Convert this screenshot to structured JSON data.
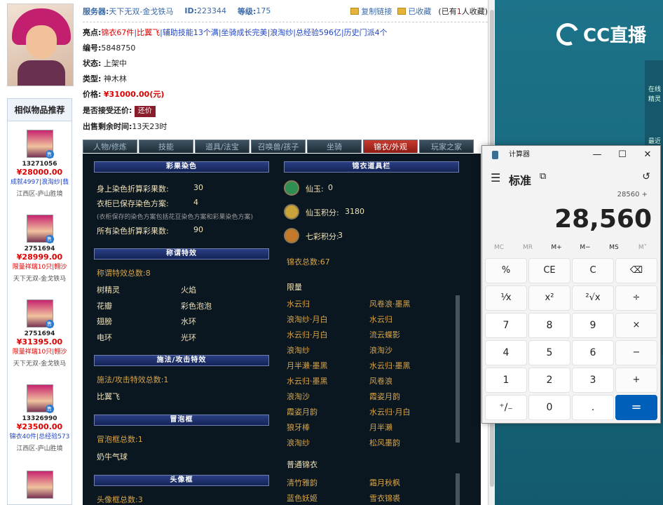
{
  "server": {
    "label": "服务器:",
    "value": "天下无双-金戈铁马",
    "id_label": "ID:",
    "id_value": "223344",
    "level_label": "等级:",
    "level_value": "175",
    "copy_link": "复制链接",
    "favorite": "已收藏",
    "fav_pre": "(已有",
    "fav_count": "1",
    "fav_post": "人收藏)"
  },
  "info": {
    "highlights_label": "亮点:",
    "highlights": [
      {
        "text": "锦衣67件",
        "red": true
      },
      {
        "text": "|",
        "red": false
      },
      {
        "text": "比翼飞",
        "red": true
      },
      {
        "text": "|辅助技能13个满|坐骑成长完美|浪淘纱|总经验596亿|历史门派4个",
        "red": false
      }
    ],
    "number_label": "编号:",
    "number": "5848750",
    "status_label": "状态:",
    "status": "上架中",
    "type_label": "类型:",
    "type": "神木林",
    "price_label": "价格:",
    "price": "¥31000.00(元)",
    "counter_label": "是否接受还价:",
    "counter_btn": "还价",
    "remaining_label": "出售剩余时间:",
    "remaining": "13天23时"
  },
  "tabs": [
    "人物/修炼",
    "技能",
    "道具/法宝",
    "召唤兽/孩子",
    "坐骑",
    "锦衣/外观",
    "玩家之家"
  ],
  "active_tab": 5,
  "similar": {
    "title": "相似物品推荐",
    "items": [
      {
        "id": "13271056",
        "price": "¥28000.00",
        "tags": "成就4997|浪淘纱|翡",
        "tag_red": false,
        "server": "江西区-庐山胜境"
      },
      {
        "id": "2751694",
        "price": "¥28999.00",
        "tags": "限量祥瑞10只|翱沙",
        "tag_red": true,
        "server": "天下无双-金戈铁马"
      },
      {
        "id": "2751694",
        "price": "¥31395.00",
        "tags": "限量祥瑞10只|翱沙",
        "tag_red": true,
        "server": "天下无双-金戈铁马"
      },
      {
        "id": "13326990",
        "price": "¥23500.00",
        "tags": "锦衣40件|总经验573",
        "tag_red": false,
        "server": "江西区-庐山胜境"
      }
    ]
  },
  "panel": {
    "dye_title": "彩果染色",
    "dye_rows": [
      {
        "k": "身上染色折算彩果数:",
        "v": "30"
      },
      {
        "k": "衣柜已保存染色方案:",
        "v": "4"
      },
      {
        "k": "所有染色折算彩果数:",
        "v": "90"
      }
    ],
    "dye_note": "(衣柜保存的染色方案包括花豆染色方案和彩果染色方案)",
    "title_title": "称谓特效",
    "title_count": "称谓特效总数:8",
    "titles": [
      "树精灵",
      "火焰",
      "花瓣",
      "彩色泡泡",
      "翅膀",
      "水环",
      "电环",
      "光环"
    ],
    "skill_title": "施法/攻击特效",
    "skill_count": "施法/攻击特效总数:1",
    "skills": [
      "比翼飞"
    ],
    "bubble_title": "冒泡框",
    "bubble_count": "冒泡框总数:1",
    "bubbles": [
      "奶牛气球"
    ],
    "head_title": "头像框",
    "head_count": "头像框总数:3",
    "wardrobe_title": "锦衣道具栏",
    "currencies": [
      {
        "k": "仙玉:",
        "v": "0",
        "color": "#2f8f53"
      },
      {
        "k": "仙玉积分:",
        "v": "3180",
        "color": "#caa33a"
      },
      {
        "k": "七彩积分:",
        "v": "3",
        "color": "#c47a28"
      }
    ],
    "costume_count": "锦衣总数:67",
    "limited_label": "限量",
    "limited": [
      "水云归",
      "风卷浪·墨黑",
      "浪淘纱·月白",
      "水云归",
      "水云归·月白",
      "流云蝶影",
      "浪淘纱",
      "浪淘沙",
      "月半瀨·墨黑",
      "水云归·墨黑",
      "水云归·墨黑",
      "风卷浪",
      "浪淘沙",
      "霞姿月韵",
      "霞姿月韵",
      "水云归·月白",
      "狼牙棒",
      "月半瀨",
      "浪淘纱",
      "松风墨韵"
    ],
    "normal_label": "普通锦衣",
    "normal": [
      "清竹雅韵",
      "霜月秋枫",
      "蓝色妖姬",
      "雪衣锦裘"
    ]
  },
  "calculator": {
    "app_title": "计算器",
    "mode": "标准",
    "expression": "28560 +",
    "display": "28,560",
    "memory": [
      "MC",
      "MR",
      "M+",
      "M−",
      "MS",
      "M˅"
    ],
    "keys": [
      [
        "%",
        "CE",
        "C",
        "⌫"
      ],
      [
        "¹⁄x",
        "x²",
        "²√x",
        "÷"
      ],
      [
        "7",
        "8",
        "9",
        "×"
      ],
      [
        "4",
        "5",
        "6",
        "−"
      ],
      [
        "1",
        "2",
        "3",
        "+"
      ],
      [
        "⁺∕₋",
        "0",
        ".",
        "="
      ]
    ]
  },
  "stream": {
    "brand": "CC直播",
    "side": [
      "在线",
      "精灵",
      "最近"
    ]
  }
}
